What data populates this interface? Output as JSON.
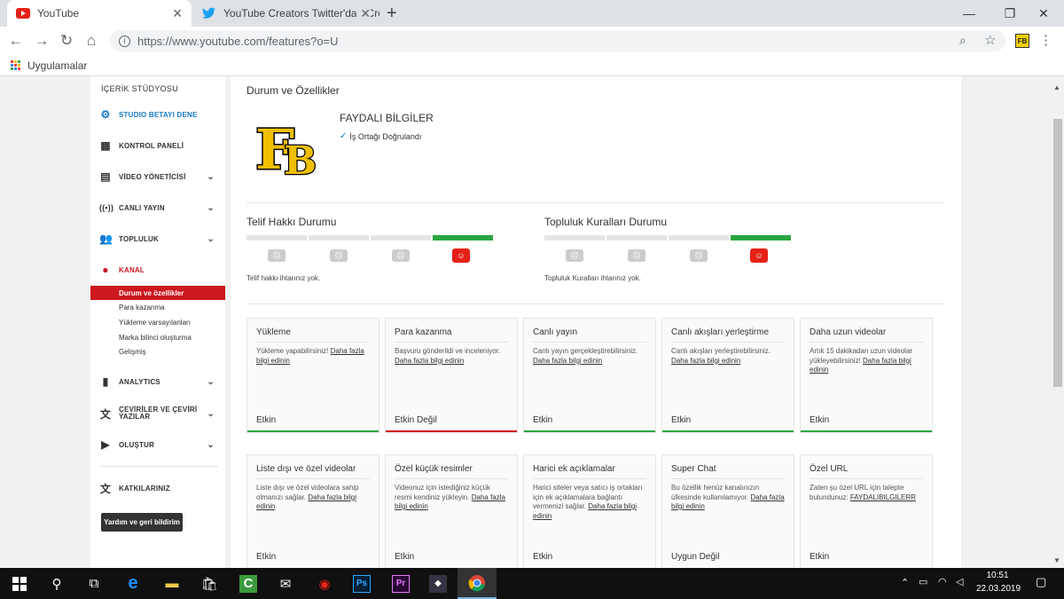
{
  "browser": {
    "tabs": [
      {
        "title": "YouTube",
        "icon": "youtube-icon"
      },
      {
        "title": "YouTube Creators Twitter'da: \"Cre",
        "icon": "twitter-icon"
      }
    ],
    "new_tab": "+",
    "url": "https://www.youtube.com/features?o=U",
    "bookmarks_label": "Uygulamalar"
  },
  "sidebar": {
    "title": "İÇERİK STÜDYOSU",
    "beta": "STUDIO BETAYI DENE",
    "items": [
      {
        "label": "KONTROL PANELİ",
        "icon": "dashboard-icon"
      },
      {
        "label": "VİDEO YÖNETİCİSİ",
        "icon": "video-manager-icon"
      },
      {
        "label": "CANLI YAYIN",
        "icon": "live-icon"
      },
      {
        "label": "TOPLULUK",
        "icon": "community-icon"
      },
      {
        "label": "KANAL",
        "icon": "channel-icon"
      }
    ],
    "channel_sub": [
      "Durum ve özellikler",
      "Para kazanma",
      "Yükleme varsayılanları",
      "Marka bilinci oluşturma",
      "Gelişmiş"
    ],
    "items2": [
      {
        "label": "ANALYTICS",
        "icon": "analytics-icon"
      },
      {
        "label": "ÇEVİRİLER VE ÇEVİRİ YAZILAR",
        "icon": "translate-icon"
      },
      {
        "label": "OLUŞTUR",
        "icon": "create-icon"
      }
    ],
    "contrib": "KATKILARINIZ",
    "help": "Yardım ve geri bildirim"
  },
  "main": {
    "heading": "Durum ve Özellikler",
    "channel_name": "FAYDALI BİLGİLER",
    "verified": "İş Ortağı Doğrulandı",
    "logo_text": "FB",
    "copyright": {
      "title": "Telif Hakkı Durumu",
      "text": "Telif hakkı ihtarınız yok."
    },
    "community": {
      "title": "Topluluk Kuralları Durumu",
      "text": "Topluluk Kuralları ihtarınız yok."
    },
    "cards_row1": [
      {
        "title": "Yükleme",
        "desc": "Yükleme yapabilirsiniz!",
        "link": "Daha fazla bilgi edinin",
        "status": "Etkin",
        "state": "on"
      },
      {
        "title": "Para kazanma",
        "desc": "Başvuru gönderildi ve inceleniyor.",
        "link": "Daha fazla bilgi edinin",
        "status": "Etkin Değil",
        "state": "off"
      },
      {
        "title": "Canlı yayın",
        "desc": "Canlı yayın gerçekleştirebilirsiniz.",
        "link": "Daha fazla bilgi edinin",
        "status": "Etkin",
        "state": "on"
      },
      {
        "title": "Canlı akışları yerleştirme",
        "desc": "Canlı akışları yerleştirebilirsiniz.",
        "link": "Daha fazla bilgi edinin",
        "status": "Etkin",
        "state": "on"
      },
      {
        "title": "Daha uzun videolar",
        "desc": "Artık 15 dakikadan uzun videolar yükleyebilirsiniz!",
        "link": "Daha fazla bilgi edinin",
        "status": "Etkin",
        "state": "on"
      }
    ],
    "cards_row2": [
      {
        "title": "Liste dışı ve özel videolar",
        "desc": "Liste dışı ve özel videolara sahip olmanızı sağlar.",
        "link": "Daha fazla bilgi edinin",
        "status": "Etkin"
      },
      {
        "title": "Özel küçük resimler",
        "desc": "Videonuz için istediğiniz küçük resmi kendiniz yükleyin.",
        "link": "Daha fazla bilgi edinin",
        "status": "Etkin"
      },
      {
        "title": "Harici ek açıklamalar",
        "desc": "Harici siteler veya satıcı iş ortakları için ek açıklamalara bağlantı vermenizi sağlar.",
        "link": "Daha fazla bilgi edinin",
        "status": "Etkin"
      },
      {
        "title": "Super Chat",
        "desc": "Bu özellik henüz kanalınızın ülkesinde kullanılamıyor.",
        "link": "Daha fazla bilgi edinin",
        "status": "Uygun Değil"
      },
      {
        "title": "Özel URL",
        "desc": "Zaten şu özel URL için talepte bulundunuz:",
        "link": "FAYDALIBILGILERR",
        "status": "Etkin"
      }
    ]
  },
  "taskbar": {
    "time": "10:51",
    "date": "22.03.2019"
  },
  "colors": {
    "active": "#2ba640",
    "inactive": "#cc181e",
    "brand": "#e62117"
  }
}
